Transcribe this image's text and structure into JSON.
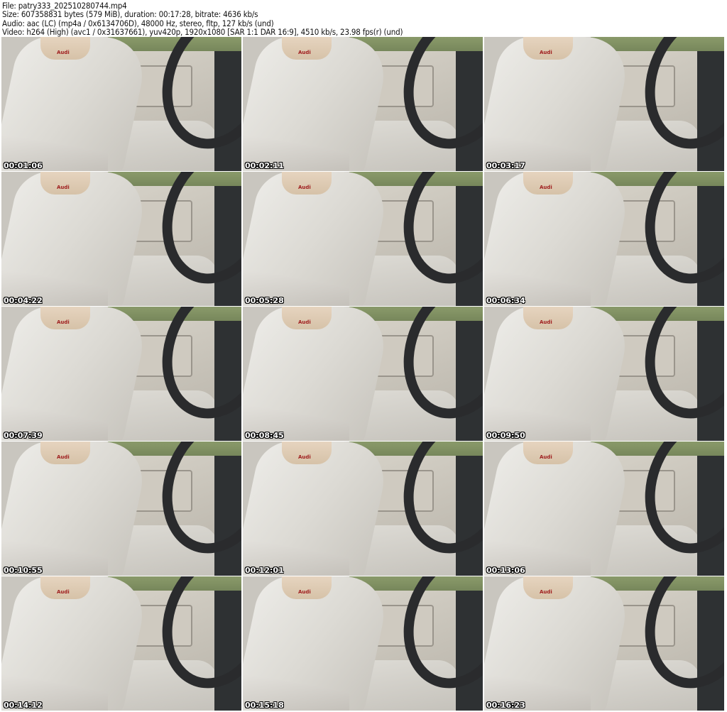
{
  "header": {
    "file": "File: patry333_202510280744.mp4",
    "size": "Size: 607358831 bytes (579 MiB), duration: 00:17:28, bitrate: 4636 kb/s",
    "audio": "Audio: aac (LC) (mp4a / 0x6134706D), 48000 Hz, stereo, fltp, 127 kb/s (und)",
    "video": "Video: h264 (High) (avc1 / 0x31637661), yuv420p, 1920x1080 [SAR 1:1 DAR 16:9], 4510 kb/s, 23.98 fps(r) (und)"
  },
  "thumbnails": [
    {
      "timestamp": "00:01:06"
    },
    {
      "timestamp": "00:02:11"
    },
    {
      "timestamp": "00:03:17"
    },
    {
      "timestamp": "00:04:22"
    },
    {
      "timestamp": "00:05:28"
    },
    {
      "timestamp": "00:06:34"
    },
    {
      "timestamp": "00:07:39"
    },
    {
      "timestamp": "00:08:45"
    },
    {
      "timestamp": "00:09:50"
    },
    {
      "timestamp": "00:10:55"
    },
    {
      "timestamp": "00:12:01"
    },
    {
      "timestamp": "00:13:06"
    },
    {
      "timestamp": "00:14:12"
    },
    {
      "timestamp": "00:15:18"
    },
    {
      "timestamp": "00:16:23"
    }
  ],
  "headrest_logo": "Audi"
}
